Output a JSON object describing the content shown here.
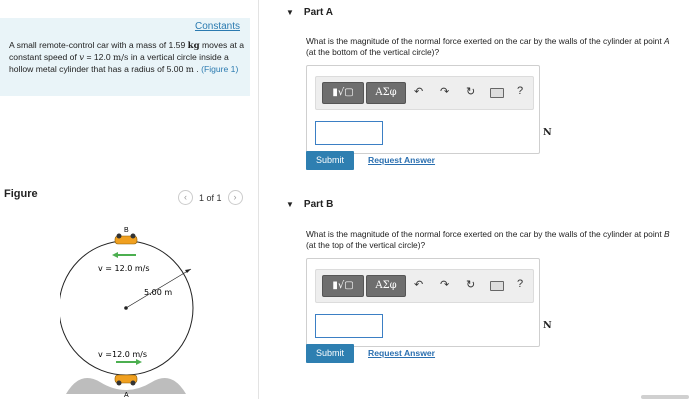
{
  "problem": {
    "constants_link": "Constants",
    "text_1": "A small remote-control car with a mass of 1.59 ",
    "unit_kg": "kg",
    "text_2": " moves at a constant speed of ",
    "var_v": "v",
    "text_3": " = 12.0 ",
    "unit_ms": "m/s",
    "text_4": " in a vertical circle inside a hollow metal cylinder that has a radius of 5.00 ",
    "unit_m": "m",
    "text_5": " .",
    "figure_link": "(Figure 1)"
  },
  "figure": {
    "header": "Figure",
    "pager": "1 of 1",
    "prev_icon": "chevron-left-icon",
    "next_icon": "chevron-right-icon",
    "label_top": "B",
    "label_bottom": "A",
    "speed_top": "v = 12.0 m/s",
    "speed_bottom": "v =12.0 m/s",
    "radius_label": "5.00 m",
    "arrow_color": "#4caf50",
    "car_color": "#f0a020"
  },
  "parts": [
    {
      "header": "Part A",
      "question_1": "What is the magnitude of the normal force exerted on the car by the walls of the cylinder at point ",
      "point": "A",
      "question_2": " (at the bottom of the vertical circle)?",
      "unit": "N",
      "submit": "Submit",
      "request": "Request Answer"
    },
    {
      "header": "Part B",
      "question_1": "What is the magnitude of the normal force exerted on the car by the walls of the cylinder at point ",
      "point": "B",
      "question_2": " (at the top of the vertical circle)?",
      "unit": "N",
      "submit": "Submit",
      "request": "Request Answer"
    }
  ],
  "toolbar": {
    "math_label": "▮√▢",
    "greek_label": "ΑΣφ",
    "undo": "↶",
    "redo": "↷",
    "reset": "↻",
    "keyboard_icon": "keyboard-icon",
    "help": "?"
  },
  "colors": {
    "accent": "#2e7fb1",
    "problem_bg": "#e9f4f8",
    "input_border": "#3b7fc4"
  }
}
